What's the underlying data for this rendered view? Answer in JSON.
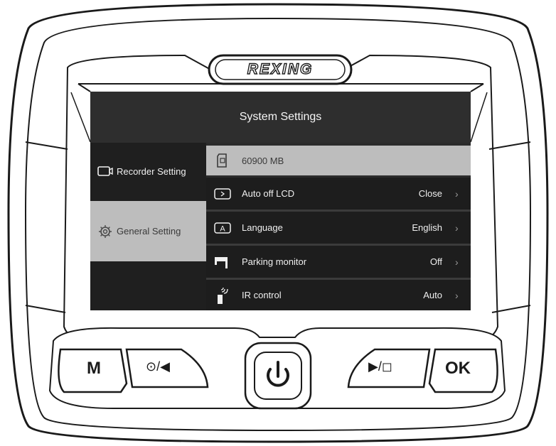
{
  "brand": "REXING",
  "screen": {
    "title": "System Settings",
    "sidebar": [
      {
        "label": "Recorder Setting",
        "icon": "camera-icon"
      },
      {
        "label": "General Setting",
        "icon": "gear-icon",
        "selected": true
      }
    ],
    "storage": {
      "label": "60900 MB",
      "icon": "sd-card-icon"
    },
    "rows": [
      {
        "label": "Auto off LCD",
        "value": "Close",
        "icon": "screen-off-icon"
      },
      {
        "label": "Language",
        "value": "English",
        "icon": "language-icon"
      },
      {
        "label": "Parking monitor",
        "value": "Off",
        "icon": "parking-icon"
      },
      {
        "label": "IR control",
        "value": "Auto",
        "icon": "ir-remote-icon"
      }
    ],
    "chevron": "›"
  },
  "buttons": {
    "m": "M",
    "ok": "OK",
    "rewind": "⊙/◀",
    "play": "▶/◻"
  },
  "colors": {
    "screen_bg": "#2b2b2b",
    "row_bg": "#1d1d1d",
    "selected_bg": "#bdbdbd"
  }
}
